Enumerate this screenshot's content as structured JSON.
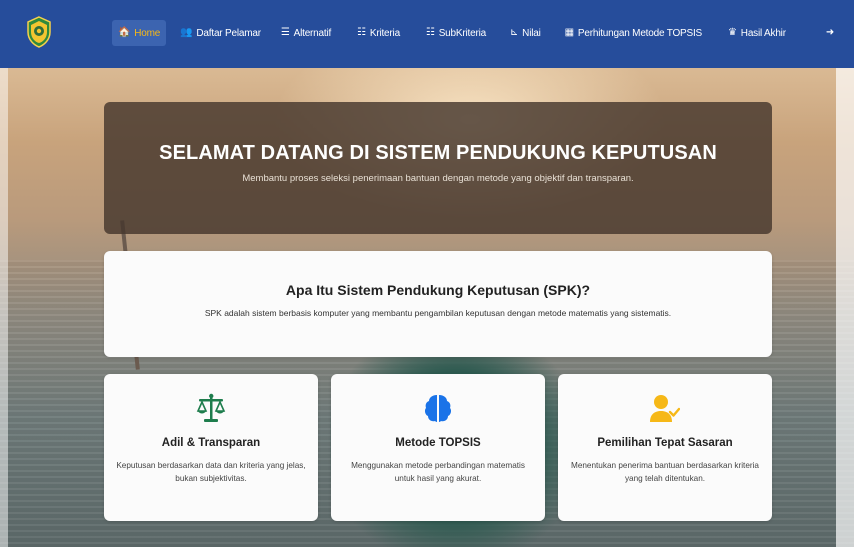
{
  "nav": {
    "items": [
      {
        "key": "home",
        "icon": "home-icon",
        "glyph": "🏠",
        "label": "Home"
      },
      {
        "key": "daftar",
        "icon": "users-icon",
        "glyph": "👥",
        "label": "Daftar Pelamar"
      },
      {
        "key": "alternatif",
        "icon": "list-icon",
        "glyph": "☰",
        "label": "Alternatif"
      },
      {
        "key": "kriteria",
        "icon": "list-ordered-icon",
        "glyph": "☷",
        "label": "Kriteria"
      },
      {
        "key": "subkriteria",
        "icon": "list-check-icon",
        "glyph": "☷",
        "label": "SubKriteria"
      },
      {
        "key": "nilai",
        "icon": "chart-icon",
        "glyph": "⊾",
        "label": "Nilai"
      },
      {
        "key": "perhitungan",
        "icon": "calculator-icon",
        "glyph": "▦",
        "label": "Perhitungan Metode TOPSIS"
      },
      {
        "key": "hasil",
        "icon": "award-icon",
        "glyph": "♛",
        "label": "Hasil Akhir"
      }
    ],
    "logout_glyph": "➜",
    "active_color": "#f6b817",
    "bar_color": "#264d9b"
  },
  "hero": {
    "title": "SELAMAT DATANG DI SISTEM PENDUKUNG KEPUTUSAN",
    "subtitle": "Membantu proses seleksi penerimaan bantuan dengan metode yang objektif dan transparan."
  },
  "info": {
    "title": "Apa Itu Sistem Pendukung Keputusan (SPK)?",
    "text": "SPK adalah sistem berbasis komputer yang membantu pengambilan keputusan dengan metode matematis yang sistematis."
  },
  "cards": [
    {
      "icon": "scale-icon",
      "color": "#1e7d4d",
      "title": "Adil & Transparan",
      "text": "Keputusan berdasarkan data dan kriteria yang jelas, bukan subjektivitas."
    },
    {
      "icon": "brain-icon",
      "color": "#1a73e8",
      "title": "Metode TOPSIS",
      "text": "Menggunakan metode perbandingan matematis untuk hasil yang akurat."
    },
    {
      "icon": "user-check-icon",
      "color": "#f6b817",
      "title": "Pemilihan Tepat Sasaran",
      "text": "Menentukan penerima bantuan berdasarkan kriteria yang telah ditentukan."
    }
  ]
}
